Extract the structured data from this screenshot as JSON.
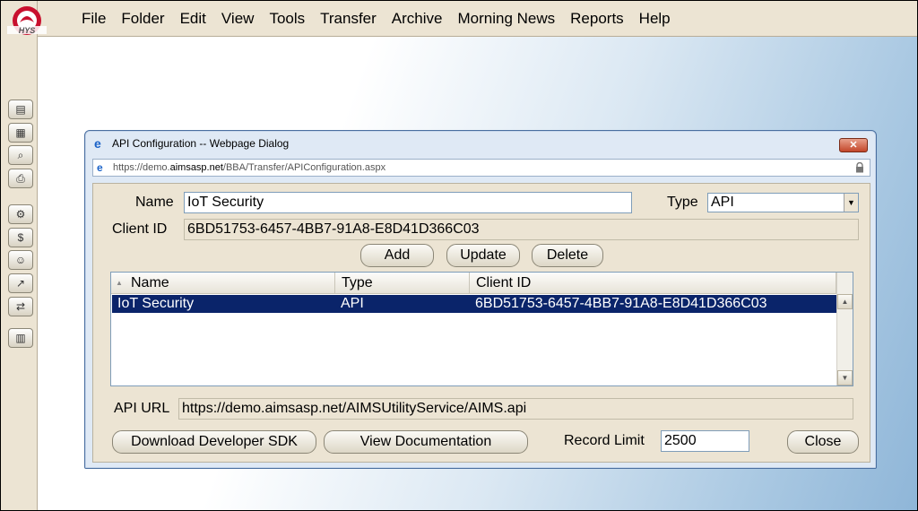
{
  "app": {
    "logo_text": "HYS"
  },
  "menubar": {
    "items": [
      "File",
      "Folder",
      "Edit",
      "View",
      "Tools",
      "Transfer",
      "Archive",
      "Morning News",
      "Reports",
      "Help"
    ]
  },
  "rail": {
    "icons": [
      "list-icon",
      "document-icon",
      "search-icon",
      "printer-icon",
      "settings-icon",
      "dollar-icon",
      "people-icon",
      "chart-icon",
      "transfer-icon",
      "report-icon"
    ]
  },
  "dialog": {
    "title": "API Configuration -- Webpage Dialog",
    "url_prefix": "https://demo.",
    "url_host": "aimsasp.net",
    "url_path": "/BBA/Transfer/APIConfiguration.aspx",
    "close_glyph": "✕",
    "name_label": "Name",
    "name_value": "IoT Security",
    "type_label": "Type",
    "type_value": "API",
    "client_id_label": "Client ID",
    "client_id_value": "6BD51753-6457-4BB7-91A8-E8D41D366C03",
    "add_label": "Add",
    "update_label": "Update",
    "delete_label": "Delete",
    "grid": {
      "columns": [
        "Name",
        "Type",
        "Client ID"
      ],
      "rows": [
        {
          "name": "IoT Security",
          "type": "API",
          "client_id": "6BD51753-6457-4BB7-91A8-E8D41D366C03"
        }
      ]
    },
    "api_url_label": "API URL",
    "api_url_value": "https://demo.aimsasp.net/AIMSUtilityService/AIMS.api",
    "download_sdk_label": "Download Developer SDK",
    "view_docs_label": "View Documentation",
    "record_limit_label": "Record Limit",
    "record_limit_value": "2500",
    "close_label": "Close"
  },
  "colors": {
    "selection": "#0a246a",
    "panel": "#ece4d3",
    "dialog_frame": "#dfe9f5"
  }
}
